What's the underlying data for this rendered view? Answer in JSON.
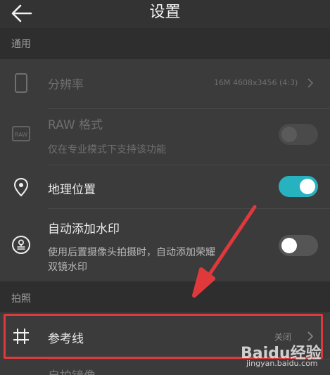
{
  "header": {
    "title": "设置"
  },
  "sections": {
    "general": "通用",
    "photo": "拍照"
  },
  "rows": {
    "resolution": {
      "label": "分辨率",
      "value": "16M 4608x3456 (4:3)"
    },
    "raw": {
      "label": "RAW 格式",
      "sub": "仅在专业模式下支持该功能",
      "enabled": false
    },
    "location": {
      "label": "地理位置",
      "enabled": true
    },
    "watermark": {
      "label": "自动添加水印",
      "sub_line1": "使用后置摄像头拍摄时，自动添加荣耀",
      "sub_line2": "双镜水印",
      "enabled": false
    },
    "gridlines": {
      "label": "参考线",
      "value": "关闭"
    },
    "selfie_mirror": {
      "label": "自拍镜像"
    }
  },
  "watermark_overlay": {
    "logo": "Baidu经验",
    "url": "jingyan.baidu.com"
  },
  "colors": {
    "accent": "#26b3bf",
    "annotation": "#e0393b"
  }
}
